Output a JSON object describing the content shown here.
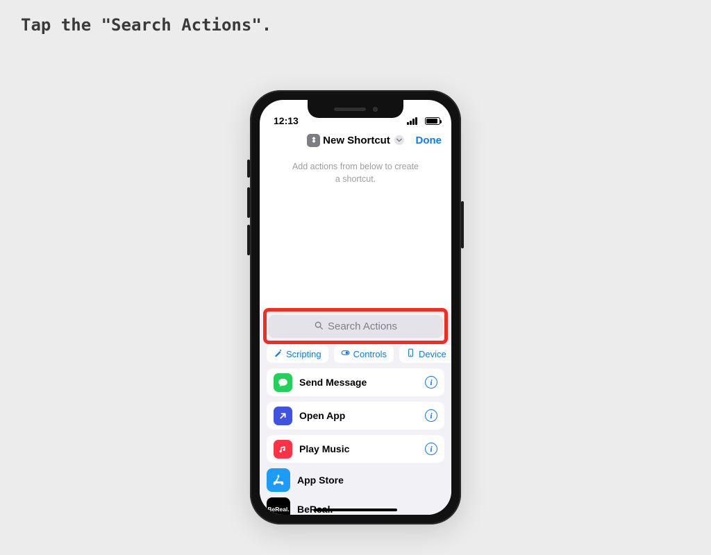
{
  "instruction": "Tap the \"Search Actions\".",
  "status": {
    "time": "12:13"
  },
  "nav": {
    "icon": "shortcuts-icon",
    "title": "New Shortcut",
    "chevron": "chevron-down-icon",
    "done": "Done"
  },
  "canvas_hint_line1": "Add actions from below to create",
  "canvas_hint_line2": "a shortcut.",
  "search": {
    "placeholder": "Search Actions"
  },
  "chips": [
    {
      "icon": "wand-icon",
      "label": "Scripting"
    },
    {
      "icon": "switch-icon",
      "label": "Controls"
    },
    {
      "icon": "phone-icon",
      "label": "Device"
    }
  ],
  "actions": [
    {
      "app_icon": "messages-icon",
      "label": "Send Message",
      "info": true,
      "icon_class": "ai-messages"
    },
    {
      "app_icon": "open-app-icon",
      "label": "Open App",
      "info": true,
      "icon_class": "ai-shortcuts"
    },
    {
      "app_icon": "music-icon",
      "label": "Play Music",
      "info": true,
      "icon_class": "ai-music"
    }
  ],
  "apps": [
    {
      "app_icon": "appstore-icon",
      "label": "App Store",
      "icon_class": "ai-appstore"
    },
    {
      "app_icon": "bereal-icon",
      "label": "BeReal.",
      "icon_class": "ai-bereal",
      "text": "BeReal."
    }
  ]
}
